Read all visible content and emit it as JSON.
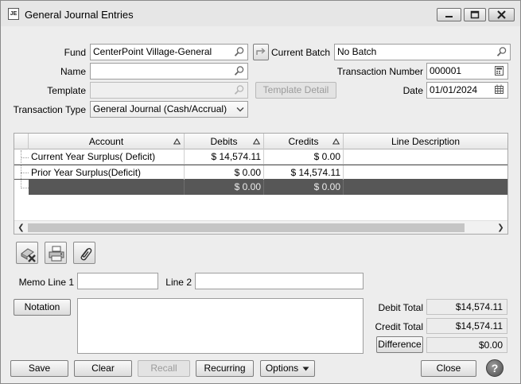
{
  "window": {
    "title": "General Journal Entries",
    "icon_text": "JE",
    "controls": [
      "minimize-icon",
      "restore-icon",
      "close-icon"
    ]
  },
  "form": {
    "fund_label": "Fund",
    "fund_value": "CenterPoint Village-General",
    "current_batch_label": "Current Batch",
    "current_batch_value": "No Batch",
    "name_label": "Name",
    "name_value": "",
    "transaction_number_label": "Transaction Number",
    "transaction_number_value": "000001",
    "template_label": "Template",
    "template_value": "",
    "template_detail_button": "Template Detail",
    "date_label": "Date",
    "date_value": "01/01/2024",
    "transaction_type_label": "Transaction Type",
    "transaction_type_value": "General Journal (Cash/Accrual)"
  },
  "grid": {
    "columns": [
      "Account",
      "Debits",
      "Credits",
      "Line Description"
    ],
    "rows": [
      {
        "account": "Current Year Surplus( Deficit)",
        "debits": "$ 14,574.11",
        "credits": "$ 0.00",
        "description": ""
      },
      {
        "account": "Prior Year Surplus(Deficit)",
        "debits": "$ 0.00",
        "credits": "$ 14,574.11",
        "description": ""
      }
    ],
    "total": {
      "account": "",
      "debits": "$ 0.00",
      "credits": "$ 0.00",
      "description": ""
    }
  },
  "toolbar_icons": [
    "delete-line-icon",
    "print-icon",
    "attachment-icon"
  ],
  "memo": {
    "memo_line1_label": "Memo Line 1",
    "memo_line1_value": "",
    "line2_label": "Line 2",
    "line2_value": ""
  },
  "notation": {
    "button_label": "Notation",
    "value": ""
  },
  "totals": {
    "debit_total_label": "Debit Total",
    "debit_total_value": "$14,574.11",
    "credit_total_label": "Credit Total",
    "credit_total_value": "$14,574.11",
    "difference_label": "Difference",
    "difference_value": "$0.00"
  },
  "buttons": {
    "save": "Save",
    "clear": "Clear",
    "recall": "Recall",
    "recurring": "Recurring",
    "options": "Options",
    "close": "Close",
    "help": "?"
  }
}
